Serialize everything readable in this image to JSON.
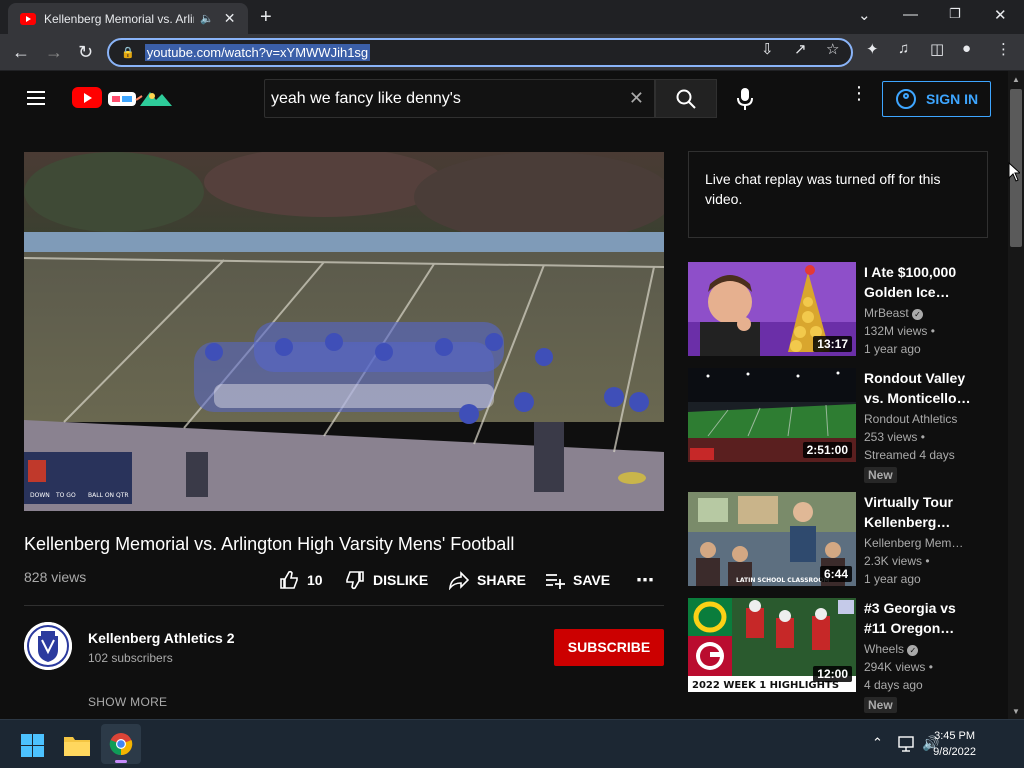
{
  "browser": {
    "tab_title": "Kellenberg Memorial vs. Arlin",
    "url": "youtube.com/watch?v=xYMWWJih1sg"
  },
  "header": {
    "search_query": "yeah we fancy like denny's",
    "sign_in": "SIGN IN"
  },
  "video": {
    "title": "Kellenberg Memorial vs. Arlington High Varsity Mens' Football",
    "views": "828 views",
    "likes": "10",
    "dislike": "DISLIKE",
    "share": "SHARE",
    "save": "SAVE",
    "channel": "Kellenberg Athletics 2",
    "subscribers": "102 subscribers",
    "subscribe": "SUBSCRIBE",
    "show_more": "SHOW MORE"
  },
  "chat": {
    "message": "Live chat replay was turned off for this video."
  },
  "recommendations": [
    {
      "title": "I Ate $100,000 Golden Ice…",
      "channel": "MrBeast",
      "verified": true,
      "views": "132M views •",
      "age": "1 year ago",
      "duration": "13:17",
      "badge": ""
    },
    {
      "title": "Rondout Valley vs. Monticello…",
      "channel": "Rondout Athletics",
      "verified": false,
      "views": "253 views •",
      "age": "Streamed 4 days",
      "duration": "2:51:00",
      "badge": "New"
    },
    {
      "title": "Virtually Tour Kellenberg…",
      "channel": "Kellenberg Mem…",
      "verified": false,
      "views": "2.3K views •",
      "age": "1 year ago",
      "duration": "6:44",
      "badge": ""
    },
    {
      "title": "#3 Georgia vs #11 Oregon…",
      "channel": "Wheels",
      "verified": true,
      "views": "294K views •",
      "age": "4 days ago",
      "duration": "12:00",
      "badge": "New"
    }
  ],
  "thumb_text": {
    "latin": "LATIN SCHOOL CLASSROOM",
    "week": "2022 WEEK 1 HIGHLIGHTS"
  },
  "scoreboard": {
    "down": "DOWN",
    "to_go": "TO GO",
    "ball_on": "BALL ON",
    "qtr": "QTR"
  },
  "taskbar": {
    "time": "3:45 PM",
    "date": "9/8/2022"
  }
}
